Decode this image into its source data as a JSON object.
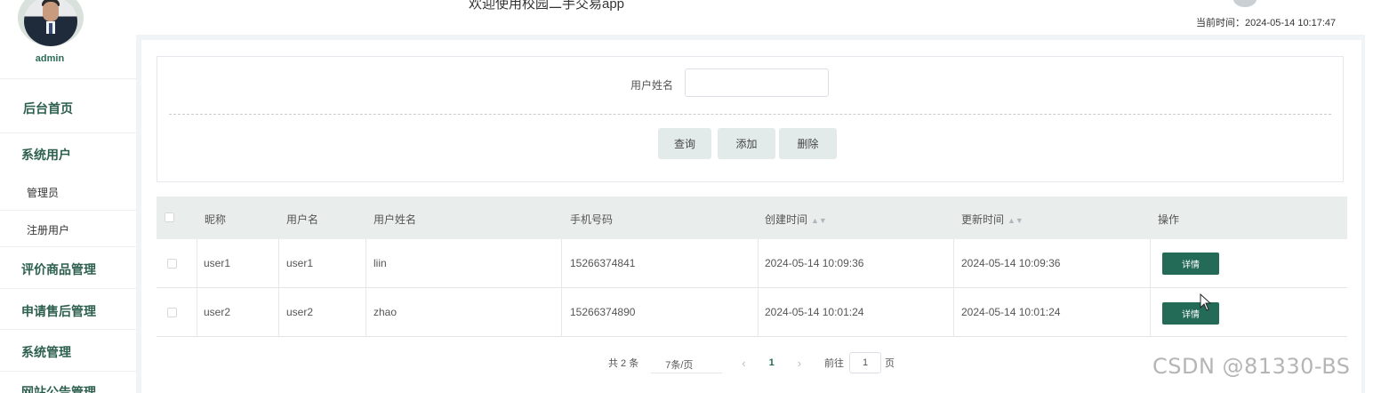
{
  "header": {
    "welcome": "欢迎使用校园二手交易app",
    "time_label": "当前时间：",
    "time_value": "2024-05-14 10:17:47"
  },
  "user": {
    "name": "admin"
  },
  "sidebar": {
    "items": [
      {
        "label": "后台首页"
      },
      {
        "label": "系统用户",
        "children": [
          {
            "label": "管理员"
          },
          {
            "label": "注册用户"
          }
        ]
      },
      {
        "label": "评价商品管理"
      },
      {
        "label": "申请售后管理"
      },
      {
        "label": "系统管理"
      },
      {
        "label": "网站公告管理"
      }
    ]
  },
  "search": {
    "label": "用户姓名",
    "value": "",
    "placeholder": "",
    "buttons": {
      "query": "查询",
      "add": "添加",
      "delete": "删除"
    }
  },
  "table": {
    "columns": [
      "昵称",
      "用户名",
      "用户姓名",
      "手机号码",
      "创建时间",
      "更新时间",
      "操作"
    ],
    "rows": [
      {
        "nickname": "user1",
        "username": "user1",
        "realname": "liin",
        "phone": "15266374841",
        "created": "2024-05-14 10:09:36",
        "updated": "2024-05-14 10:09:36",
        "action": "详情"
      },
      {
        "nickname": "user2",
        "username": "user2",
        "realname": "zhao",
        "phone": "15266374890",
        "created": "2024-05-14 10:01:24",
        "updated": "2024-05-14 10:01:24",
        "action": "详情"
      }
    ]
  },
  "pagination": {
    "total": "共 2 条",
    "page_size": "7条/页",
    "prev": "‹",
    "current_page": "1",
    "next": "›",
    "goto_label": "前往",
    "goto_value": "1",
    "page_unit": "页"
  },
  "watermark": "CSDN @81330-BS",
  "colors": {
    "accent": "#236b56",
    "menu_text": "#2d5f4f",
    "button_bg": "#e3ebea"
  }
}
